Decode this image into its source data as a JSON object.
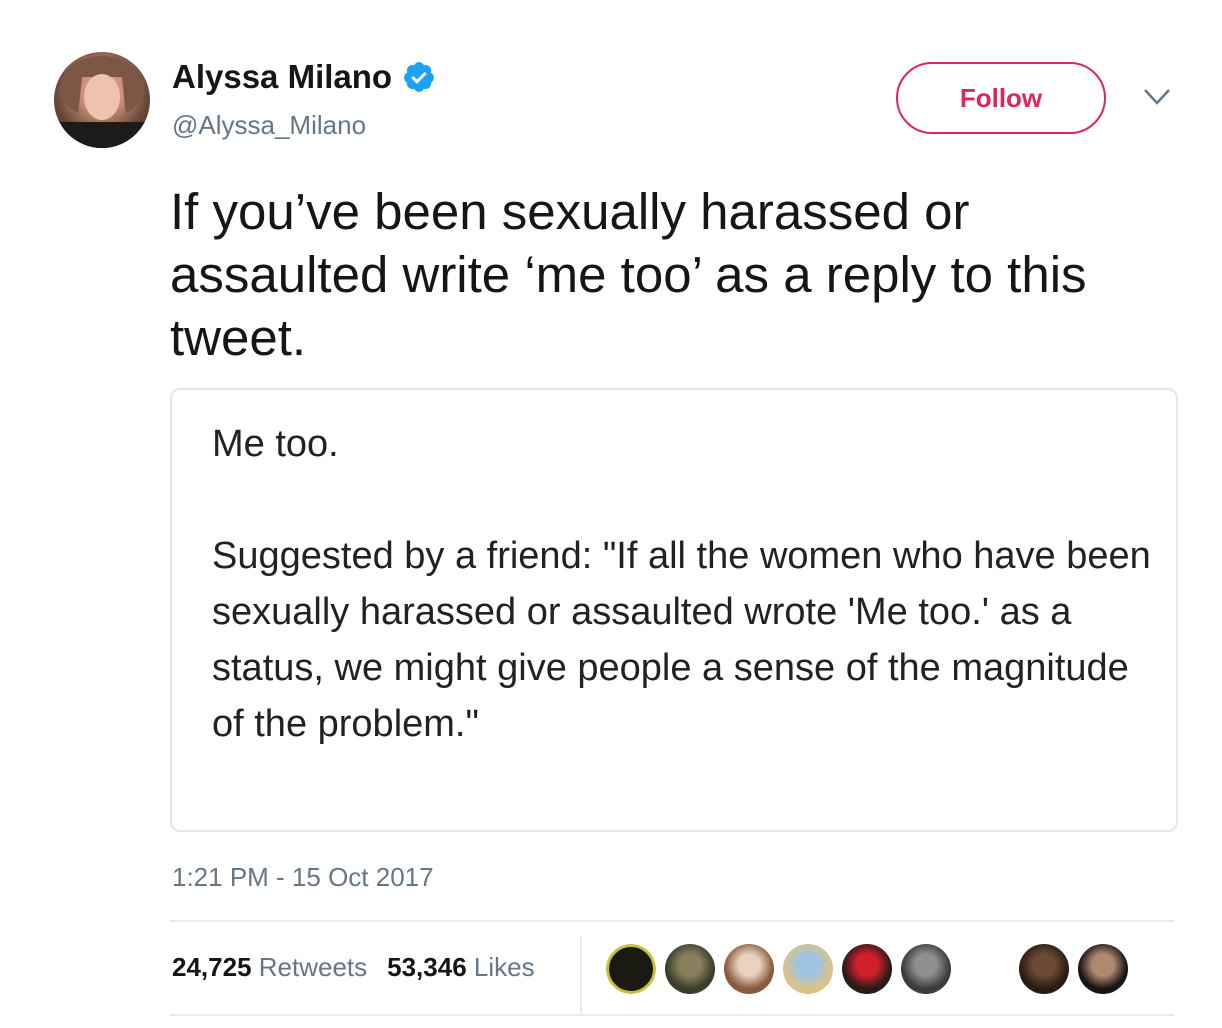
{
  "author": {
    "display_name": "Alyssa Milano",
    "handle": "@Alyssa_Milano",
    "verified": true,
    "verified_icon": "verified-badge-icon",
    "verified_color": "#1da1f2"
  },
  "actions": {
    "follow_label": "Follow",
    "follow_color": "#e0245e",
    "more_icon": "chevron-down-icon"
  },
  "tweet": {
    "text": "If you’ve been sexually harassed or assaulted write ‘me too’ as a reply to this tweet.",
    "media_text": "Me too.\n\nSuggested by a friend: \"If all the women who have been sexually harassed or assaulted wrote 'Me too.' as a status, we might give people a sense of the magnitude of the problem.\"",
    "timestamp": "1:21 PM - 15 Oct 2017"
  },
  "stats": {
    "retweets_count": "24,725",
    "retweets_label": "Retweets",
    "likes_count": "53,346",
    "likes_label": "Likes"
  },
  "likers": [
    {
      "name": "liker-avatar-1",
      "color": "#1a1a12",
      "accent": "#c8c23a"
    },
    {
      "name": "liker-avatar-2",
      "color": "#3a3f2c",
      "accent": "#8a7f5c"
    },
    {
      "name": "liker-avatar-3",
      "color": "#8a5a3c",
      "accent": "#e8d2c0"
    },
    {
      "name": "liker-avatar-4",
      "color": "#d9c28a",
      "accent": "#9fc3e0"
    },
    {
      "name": "liker-avatar-5",
      "color": "#2a1a1a",
      "accent": "#d0202a"
    },
    {
      "name": "liker-avatar-6",
      "color": "#3c3c3c",
      "accent": "#8f8f8f"
    },
    {
      "name": "liker-avatar-7",
      "color": "#ffffff",
      "accent": "#5a9a2a"
    },
    {
      "name": "liker-avatar-8",
      "color": "#2a1c14",
      "accent": "#6a4a34"
    },
    {
      "name": "liker-avatar-9",
      "color": "#1a1412",
      "accent": "#b08a70"
    }
  ]
}
